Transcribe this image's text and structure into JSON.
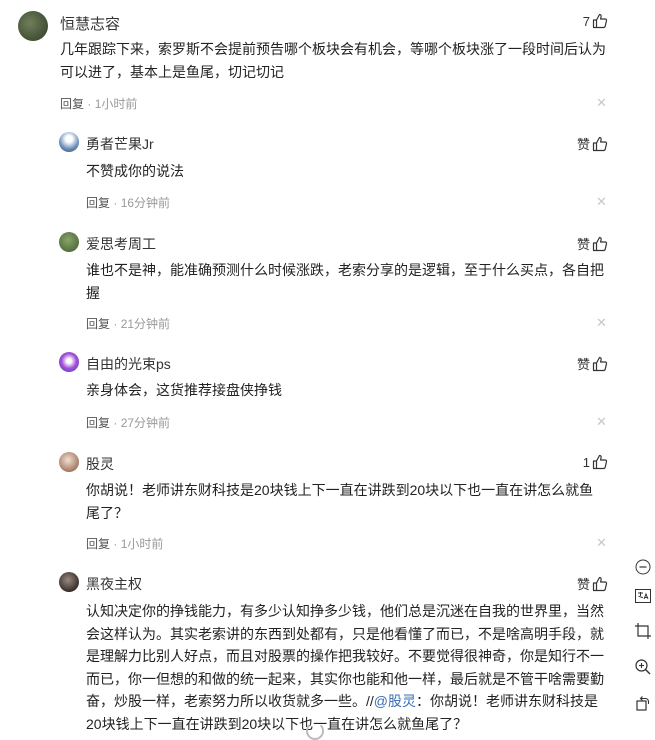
{
  "main_comment": {
    "username": "恒慧志容",
    "likes": "7",
    "text_line1": "几年跟踪下来，索罗斯不会提前预告哪个板块会有机会，等哪个板块涨了一段时间后认为",
    "text_line2": "可以进了，基本上是鱼尾，切记切记",
    "reply_label": "回复",
    "dot": "·",
    "time": "1小时前"
  },
  "replies": [
    {
      "username": "勇者芒果Jr",
      "likes": "赞",
      "lines": [
        "不赞成你的说法"
      ],
      "reply_label": "回复",
      "dot": "·",
      "time": "16分钟前"
    },
    {
      "username": "爱思考周工",
      "likes": "赞",
      "lines": [
        "谁也不是神，能准确预测什么时候涨跌，老索分享的是逻辑，至于什么买点，各自把",
        "握"
      ],
      "reply_label": "回复",
      "dot": "·",
      "time": "21分钟前"
    },
    {
      "username": "自由的光束ps",
      "likes": "赞",
      "lines": [
        "亲身体会，这货推荐接盘侠挣钱"
      ],
      "reply_label": "回复",
      "dot": "·",
      "time": "27分钟前"
    },
    {
      "username": "股灵",
      "likes": "1",
      "lines": [
        "你胡说！老师讲东财科技是20块钱上下一直在讲跌到20块以下也一直在讲怎么就鱼",
        "尾了？"
      ],
      "reply_label": "回复",
      "dot": "·",
      "time": "1小时前"
    },
    {
      "username": "黑夜主权",
      "likes": "赞",
      "lines": [
        "认知决定你的挣钱能力，有多少认知挣多少钱，他们总是沉迷在自我的世界里，当然",
        "会这样认为。其实老索讲的东西到处都有，只是他看懂了而已，不是啥高明手段，就",
        "是理解力比别人好点，而且对股票的操作把我较好。不要觉得很神奇，你是知行不一",
        "而已，你一但想的和做的统一起来，其实你也能和他一样，最后就是不管干啥需要勤",
        "奋，炒股一样，老索努力所以收货就多一些。"
      ],
      "last_line_prefix": "奋，炒股一样，老索努力所以收货就多一些。//",
      "mention": "@股灵",
      "last_line_suffix": "：你胡说！老师讲东财科技是",
      "final_line": "20块钱上下一直在讲跌到20块以下也一直在讲怎么就鱼尾了？"
    }
  ],
  "side_tools": [
    "minus-icon",
    "translate-icon",
    "crop-icon",
    "zoom-in-icon",
    "rotate-icon"
  ],
  "colors": {
    "mention": "#3b6fb6",
    "meta": "#999999",
    "close": "#c8c8c8"
  }
}
